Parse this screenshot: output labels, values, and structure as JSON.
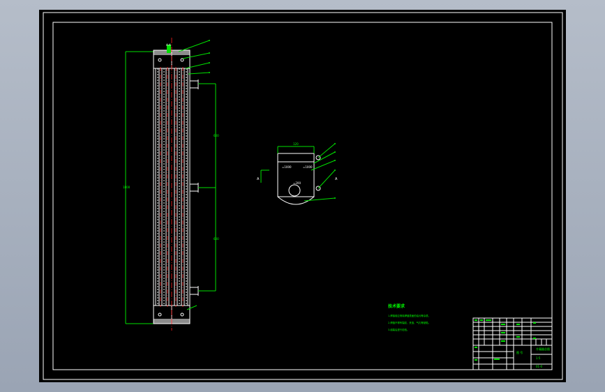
{
  "drawing": {
    "tech_requirements_title": "技术要求",
    "tech_requirements": [
      "1.焊接前应清除焊缝表面的油污等杂质。",
      "2.焊缝不得有裂纹、夹渣、气孔等缺陷。",
      "3.组装后进行检验。"
    ]
  },
  "title_block": {
    "drawing_name": "冷凝器总图",
    "sheet_code": "01-0",
    "scale_label": "1:5",
    "material_label": "图 号"
  },
  "colors": {
    "sheet_background": "#000000",
    "border": "#ffffff",
    "annotation": "#00e000",
    "centerline": "#ff2020"
  }
}
